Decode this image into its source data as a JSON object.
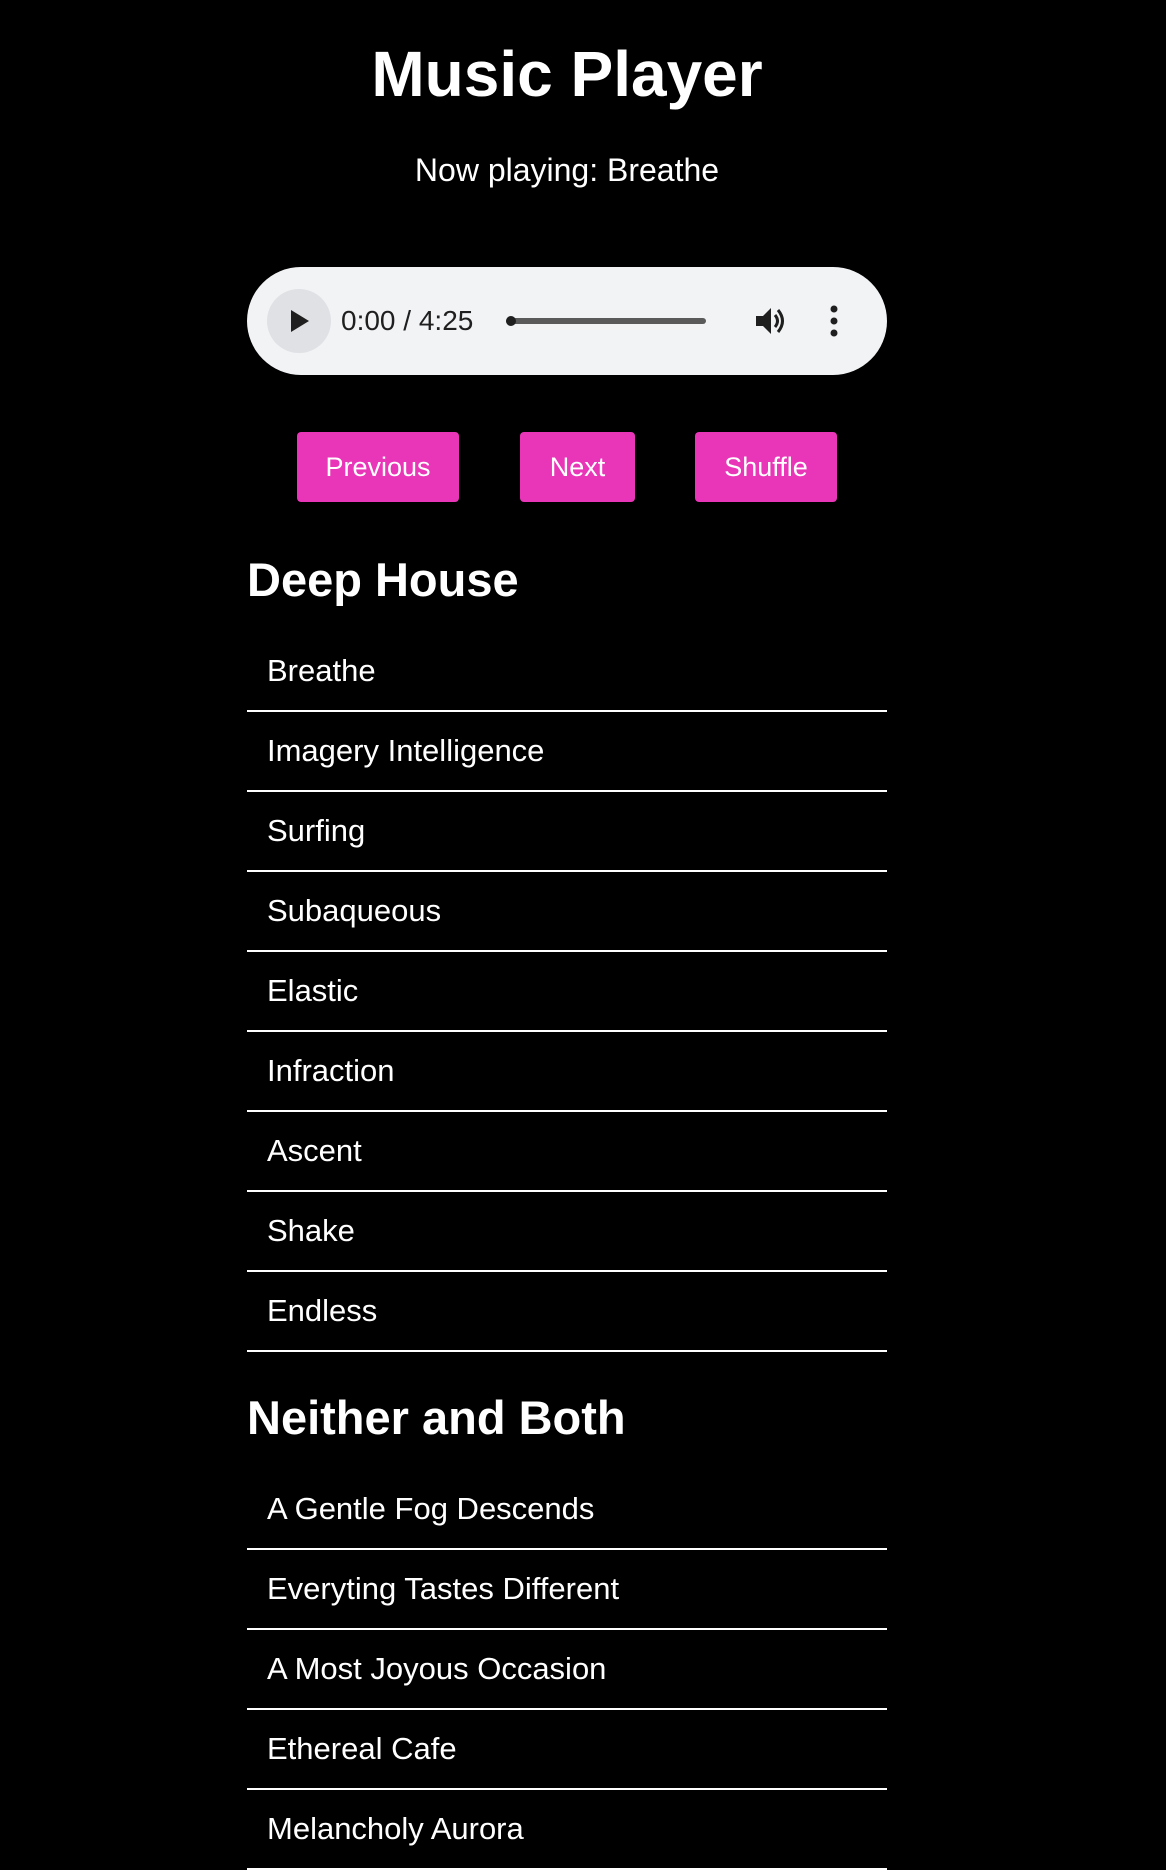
{
  "header": {
    "title": "Music Player",
    "now_playing_prefix": "Now playing: ",
    "now_playing_track": "Breathe"
  },
  "player": {
    "current_time": "0:00",
    "separator": " / ",
    "duration": "4:25",
    "progress_fraction": 0.0,
    "icons": {
      "play": "play-icon",
      "volume": "volume-icon",
      "more": "more-vertical-icon"
    }
  },
  "controls": {
    "previous_label": "Previous",
    "next_label": "Next",
    "shuffle_label": "Shuffle",
    "accent_color": "#e935b8"
  },
  "albums": [
    {
      "title": "Deep House",
      "tracks": [
        "Breathe",
        "Imagery Intelligence",
        "Surfing",
        "Subaqueous",
        "Elastic",
        "Infraction",
        "Ascent",
        "Shake",
        "Endless"
      ]
    },
    {
      "title": "Neither and Both",
      "tracks": [
        "A Gentle Fog Descends",
        "Everyting Tastes Different",
        "A Most Joyous Occasion",
        "Ethereal Cafe",
        "Melancholy Aurora"
      ]
    }
  ]
}
